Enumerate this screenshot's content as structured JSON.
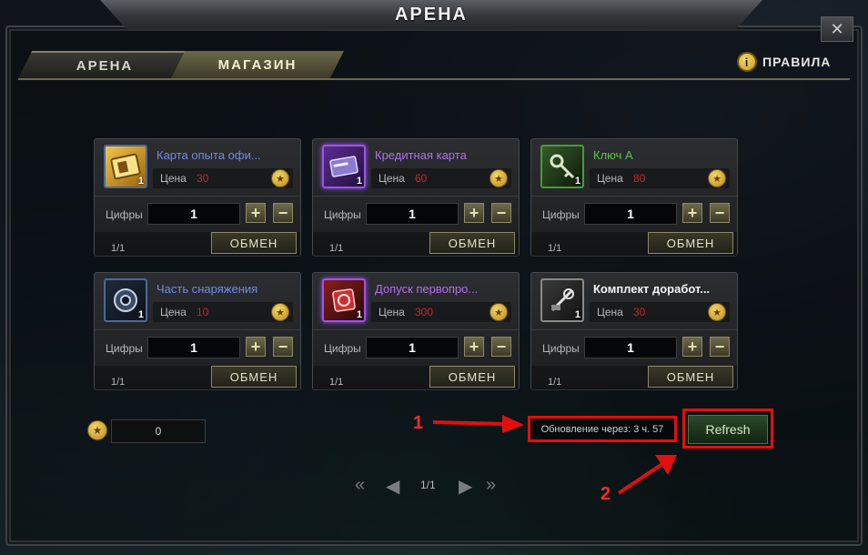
{
  "window": {
    "title": "АРЕНА",
    "close_label": "✕"
  },
  "tabs": [
    {
      "label": "АРЕНА"
    },
    {
      "label": "МАГАЗИН"
    }
  ],
  "rules": {
    "label": "ПРАВИЛА",
    "icon_text": "i"
  },
  "labels": {
    "price": "Цена",
    "digits": "Цифры",
    "exchange": "ОБМЕН",
    "plus": "+",
    "minus": "−"
  },
  "items": [
    {
      "name": "Карта опыта офи...",
      "price": "30",
      "qty": "1",
      "amount": "1",
      "page": "1/1",
      "icon": "exp-card-icon"
    },
    {
      "name": "Кредитная карта",
      "price": "60",
      "qty": "1",
      "amount": "1",
      "page": "1/1",
      "icon": "credit-card-icon"
    },
    {
      "name": "Ключ А",
      "price": "80",
      "qty": "1",
      "amount": "1",
      "page": "1/1",
      "icon": "key-icon"
    },
    {
      "name": "Часть снаряжения",
      "price": "10",
      "qty": "1",
      "amount": "1",
      "page": "1/1",
      "icon": "gear-part-icon"
    },
    {
      "name": "Допуск первопро...",
      "price": "300",
      "qty": "1",
      "amount": "1",
      "page": "1/1",
      "icon": "pass-icon"
    },
    {
      "name": "Комплект доработ...",
      "price": "30",
      "qty": "1",
      "amount": "1",
      "page": "1/1",
      "icon": "upgrade-kit-icon"
    }
  ],
  "currency": {
    "amount": "0"
  },
  "refresh": {
    "timer_text": "Обновление через: 3 ч. 57",
    "button_label": "Refresh"
  },
  "annotations": {
    "one": "1",
    "two": "2"
  },
  "pager": {
    "text": "1/1"
  },
  "colors": {
    "annotation_red": "#e01010",
    "rarity_blue": "#6c8ee8",
    "rarity_purple": "#b46ef0",
    "rarity_green": "#62c24a",
    "price_red": "#c42a2a"
  }
}
